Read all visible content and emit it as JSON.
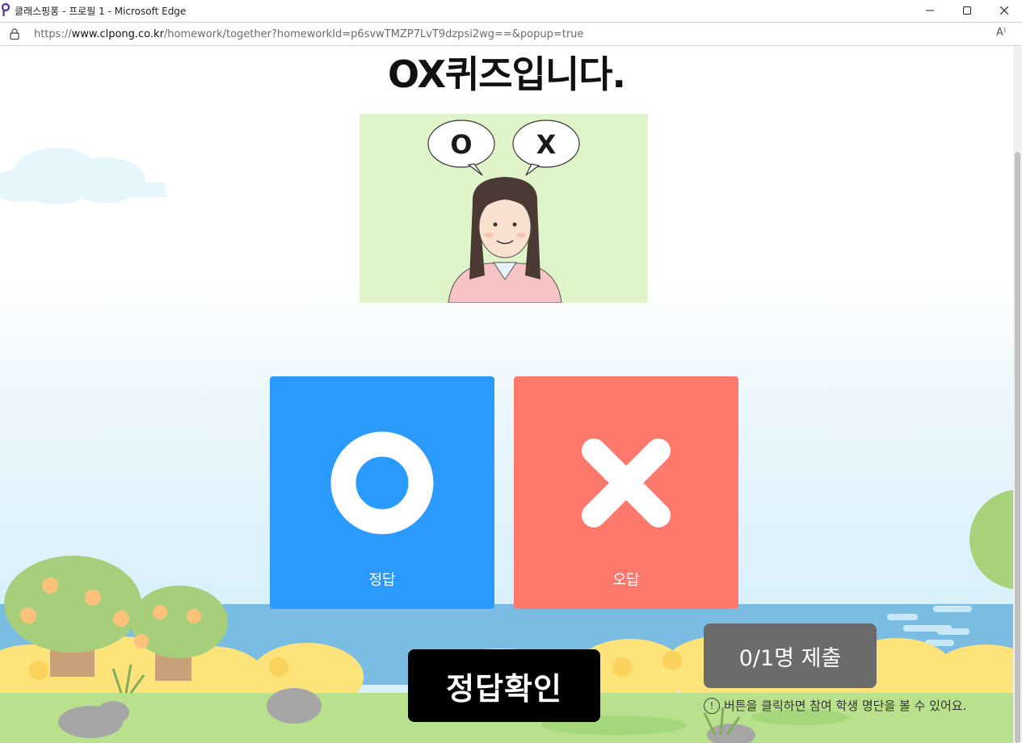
{
  "window": {
    "title": "클래스핑퐁 - 프로필 1 - Microsoft Edge",
    "minimize_glyph": "—",
    "maximize_glyph": "☐",
    "close_glyph": "✕"
  },
  "address_bar": {
    "scheme": "https://",
    "host": "www.clpong.co.kr",
    "path": "/homework/together?homeworkId=p6svwTMZP7LvT9dzpsi2wg==&popup=true",
    "read_aloud_glyph": "A⁾"
  },
  "quiz": {
    "title": "OX퀴즈입니다.",
    "illustration": {
      "bubble_o": "O",
      "bubble_x": "X"
    },
    "answer_o_label": "정답",
    "answer_x_label": "오답"
  },
  "actions": {
    "check_answer_label": "정답확인",
    "submit_status_label": "0/1명 제출",
    "hint_icon": "!",
    "hint_text": "버튼을 클릭하면 참여 학생 명단을 볼 수 있어요."
  },
  "colors": {
    "answer_o_bg": "#2b9afd",
    "answer_x_bg": "#ff786c",
    "check_button_bg": "#000000",
    "submit_button_bg": "#6b6b6b",
    "illustration_bg": "#dff4c9"
  }
}
